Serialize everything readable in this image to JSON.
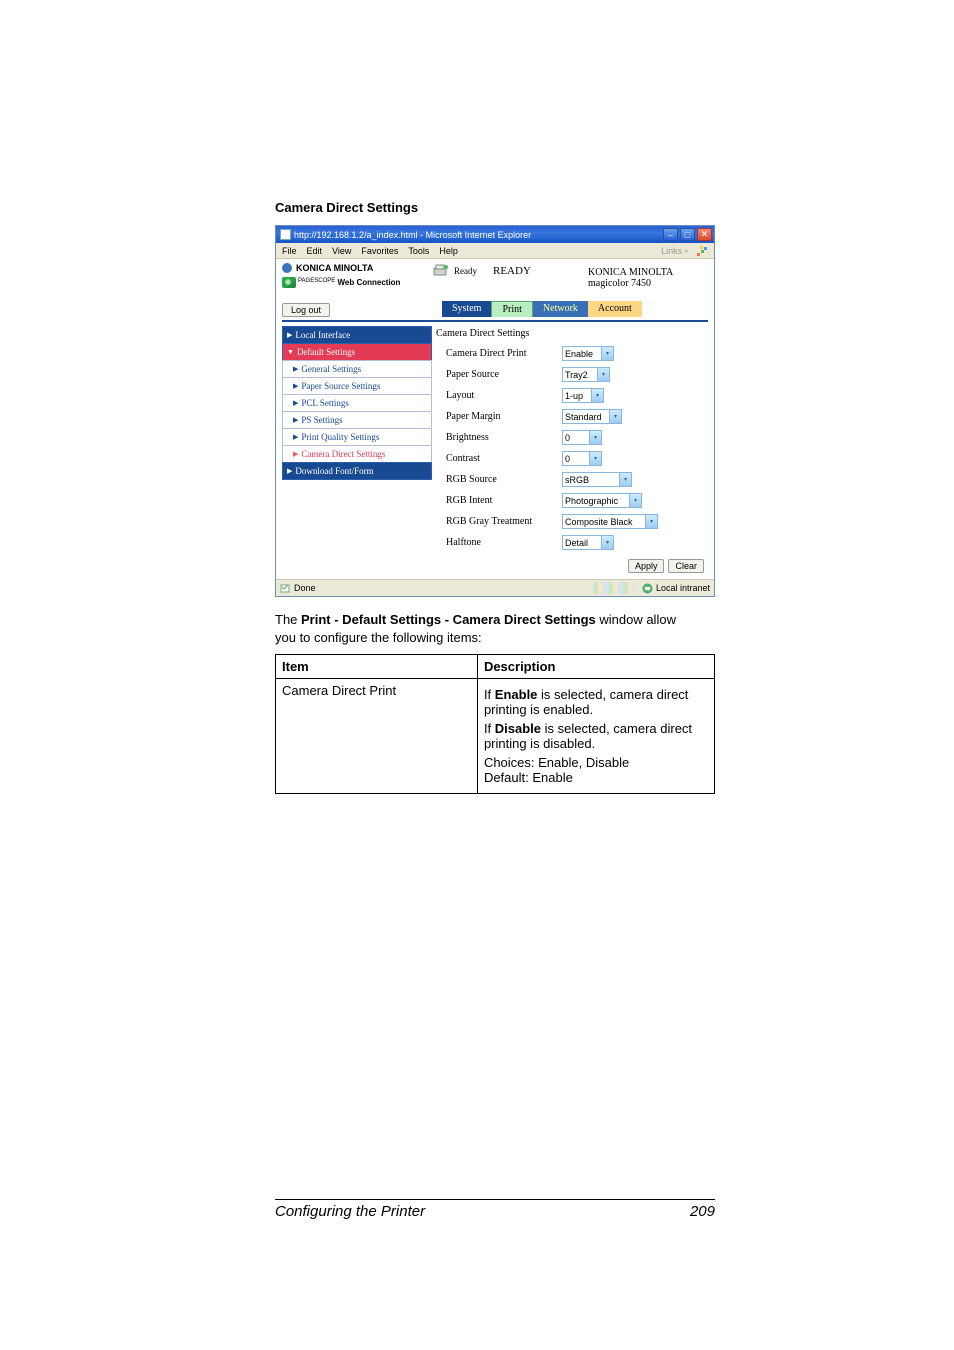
{
  "page_title": "Camera Direct Settings",
  "browser": {
    "window_title": "http://192.168.1.2/a_index.html - Microsoft Internet Explorer",
    "menus": [
      "File",
      "Edit",
      "View",
      "Favorites",
      "Tools",
      "Help"
    ],
    "links_label": "Links"
  },
  "header": {
    "brand": "KONICA MINOLTA",
    "pagescope_line1": "PAGE",
    "pagescope_line2": "SCOPE",
    "webconn": "Web Connection",
    "status_label": "Ready",
    "status_value": "READY",
    "device_brand": "KONICA MINOLTA",
    "device_model": "magicolor 7450"
  },
  "controls": {
    "logout": "Log out",
    "tabs": {
      "system": "System",
      "print": "Print",
      "network": "Network",
      "account": "Account"
    }
  },
  "sidebar": {
    "local": "Local Interface",
    "default": "Default Settings",
    "items": [
      "General Settings",
      "Paper Source Settings",
      "PCL Settings",
      "PS Settings",
      "Print Quality Settings",
      "Camera Direct Settings"
    ],
    "download": "Download Font/Form"
  },
  "panel": {
    "title": "Camera Direct Settings",
    "rows": [
      {
        "label": "Camera Direct Print",
        "value": "Enable"
      },
      {
        "label": "Paper Source",
        "value": "Tray2"
      },
      {
        "label": "Layout",
        "value": "1-up"
      },
      {
        "label": "Paper Margin",
        "value": "Standard"
      },
      {
        "label": "Brightness",
        "value": "0"
      },
      {
        "label": "Contrast",
        "value": "0"
      },
      {
        "label": "RGB Source",
        "value": "sRGB"
      },
      {
        "label": "RGB Intent",
        "value": "Photographic"
      },
      {
        "label": "RGB Gray Treatment",
        "value": "Composite Black"
      },
      {
        "label": "Halftone",
        "value": "Detail"
      }
    ],
    "apply": "Apply",
    "clear": "Clear"
  },
  "statusbar": {
    "done": "Done",
    "zone": "Local intranet"
  },
  "description": {
    "pre": "The ",
    "bold": "Print - Default Settings - Camera Direct Settings",
    "post": " window allow you to configure the following items:"
  },
  "table": {
    "head_item": "Item",
    "head_desc": "Description",
    "row_item": "Camera Direct Print",
    "p1a": "If ",
    "p1b": "Enable",
    "p1c": " is selected, camera direct printing is enabled.",
    "p2a": "If ",
    "p2b": "Disable",
    "p2c": " is selected, camera direct printing is disabled.",
    "p3": "Choices: Enable, Disable",
    "p4": "Default:  Enable"
  },
  "footer": {
    "title": "Configuring the Printer",
    "page": "209"
  }
}
